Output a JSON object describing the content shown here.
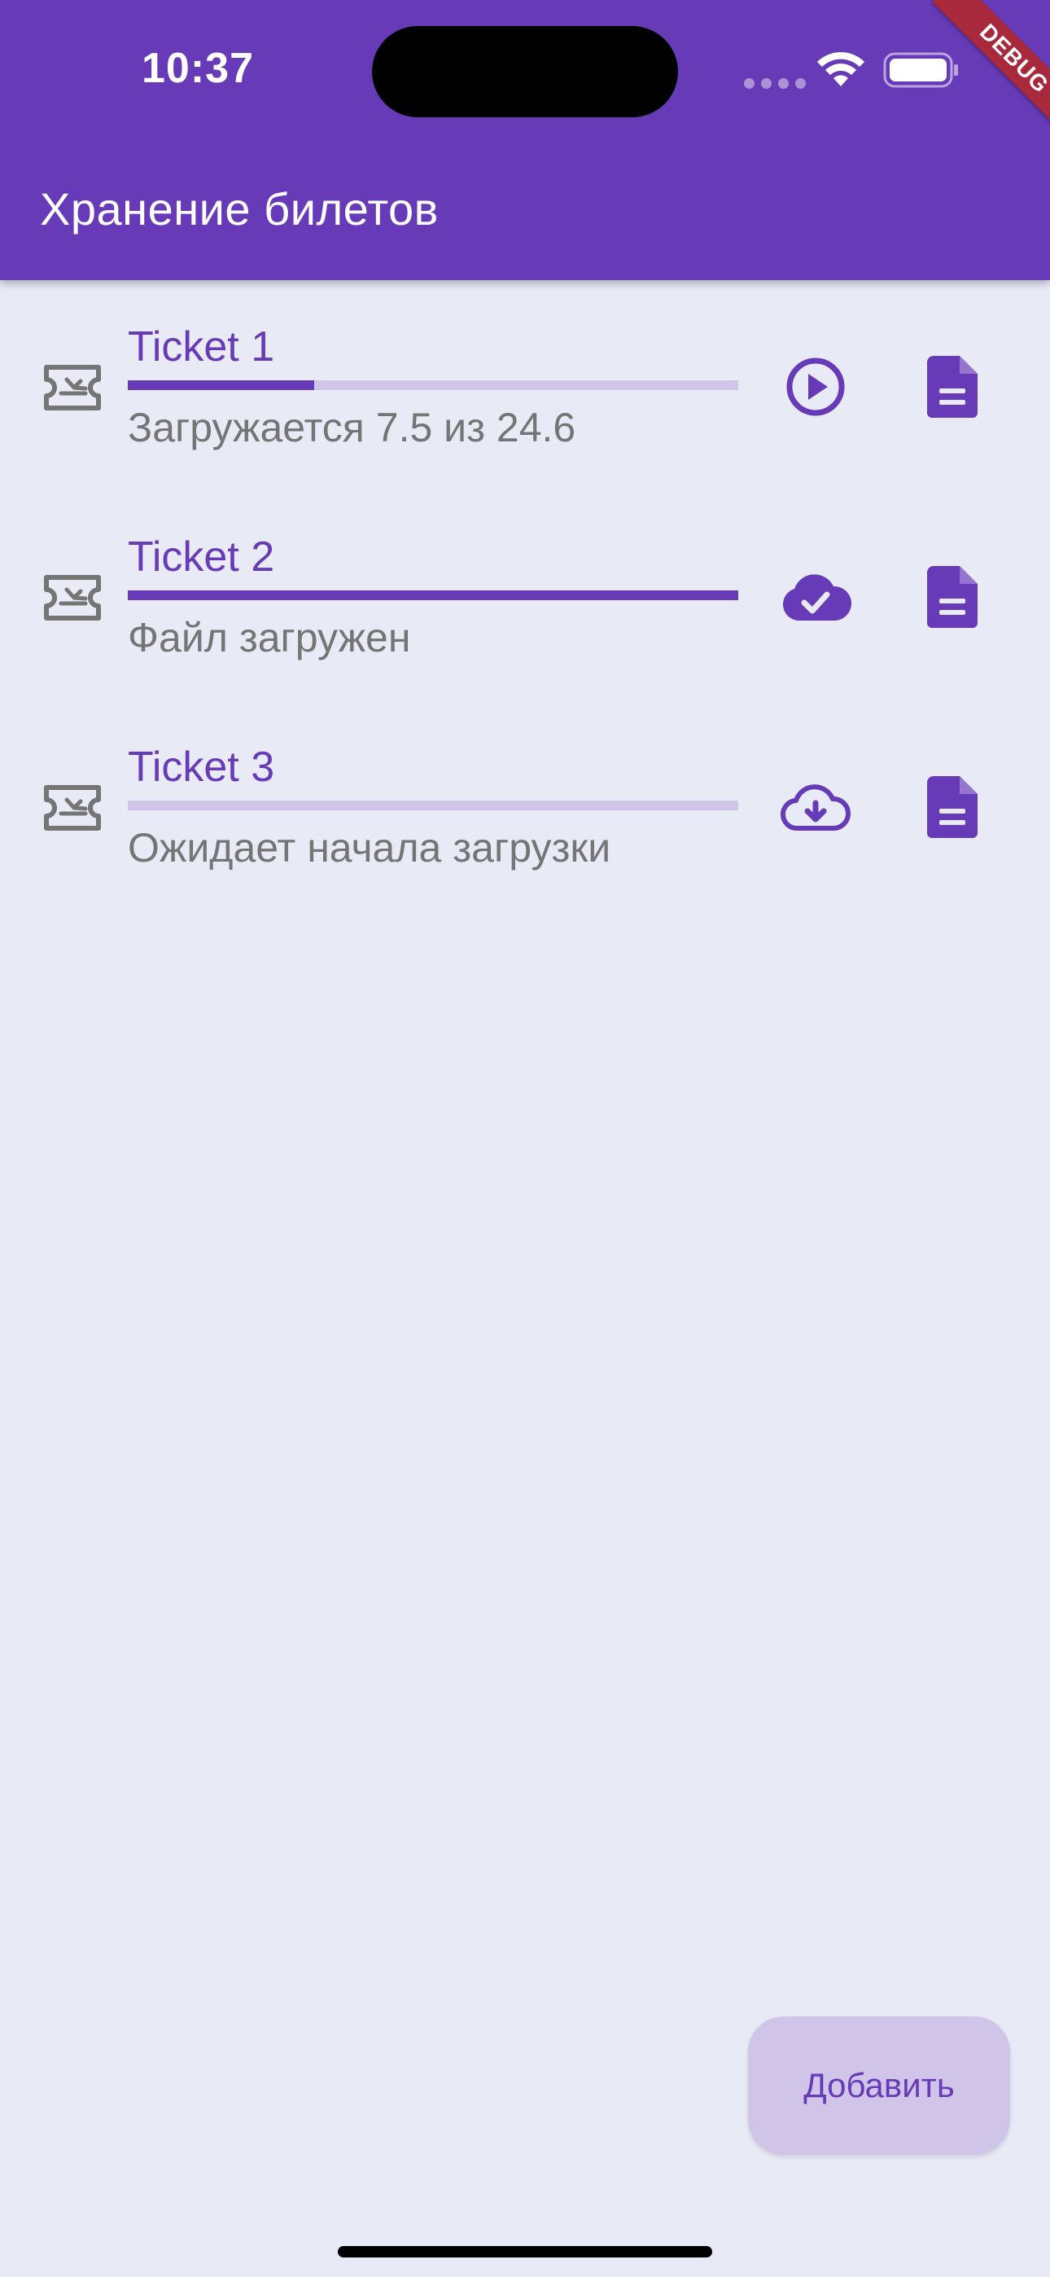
{
  "status_bar": {
    "time": "10:37"
  },
  "app_bar": {
    "title": "Хранение билетов",
    "debug_label": "DEBUG"
  },
  "colors": {
    "primary": "#673ab7",
    "primary_light": "#d1c4e9",
    "background": "#e8eaf6",
    "secondary_text": "#757575",
    "debug_ribbon": "#a8283c"
  },
  "tickets": [
    {
      "title": "Ticket 1",
      "status": "Загружается 7.5 из 24.6",
      "progress": 0.305,
      "action_icon": "play-circle-icon",
      "doc_icon": "document-icon",
      "leading_icon": "airplane-ticket-icon"
    },
    {
      "title": "Ticket 2",
      "status": "Файл загружен",
      "progress": 1.0,
      "action_icon": "cloud-done-icon",
      "doc_icon": "document-icon",
      "leading_icon": "airplane-ticket-icon"
    },
    {
      "title": "Ticket 3",
      "status": "Ожидает начала загрузки",
      "progress": 0.0,
      "action_icon": "cloud-download-icon",
      "doc_icon": "document-icon",
      "leading_icon": "airplane-ticket-icon"
    }
  ],
  "fab": {
    "label": "Добавить"
  }
}
